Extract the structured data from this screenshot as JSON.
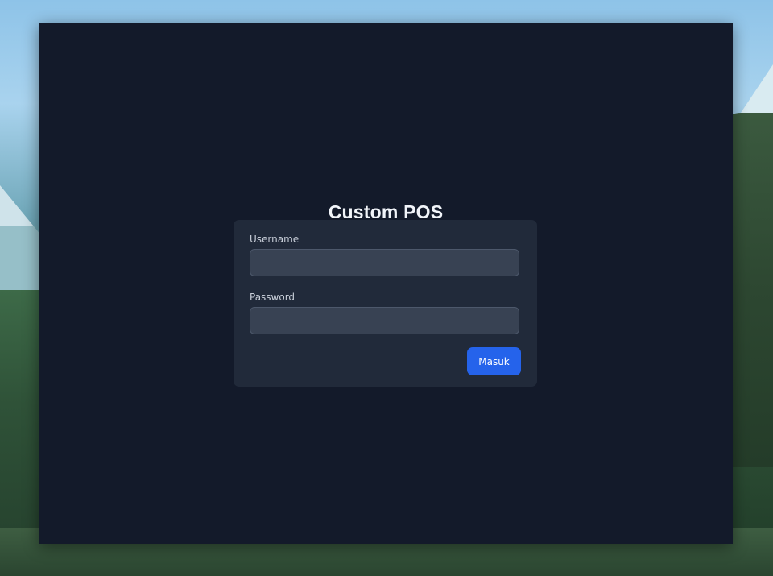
{
  "app": {
    "title": "Custom POS"
  },
  "login_form": {
    "username": {
      "label": "Username",
      "value": "",
      "placeholder": ""
    },
    "password": {
      "label": "Password",
      "value": "",
      "placeholder": ""
    },
    "submit_label": "Masuk"
  },
  "colors": {
    "window_background": "#131a2a",
    "card_background": "#212a3a",
    "input_background": "#384253",
    "accent": "#2563eb",
    "title_text": "#f1f4f9",
    "label_text": "#c9cfd9"
  }
}
